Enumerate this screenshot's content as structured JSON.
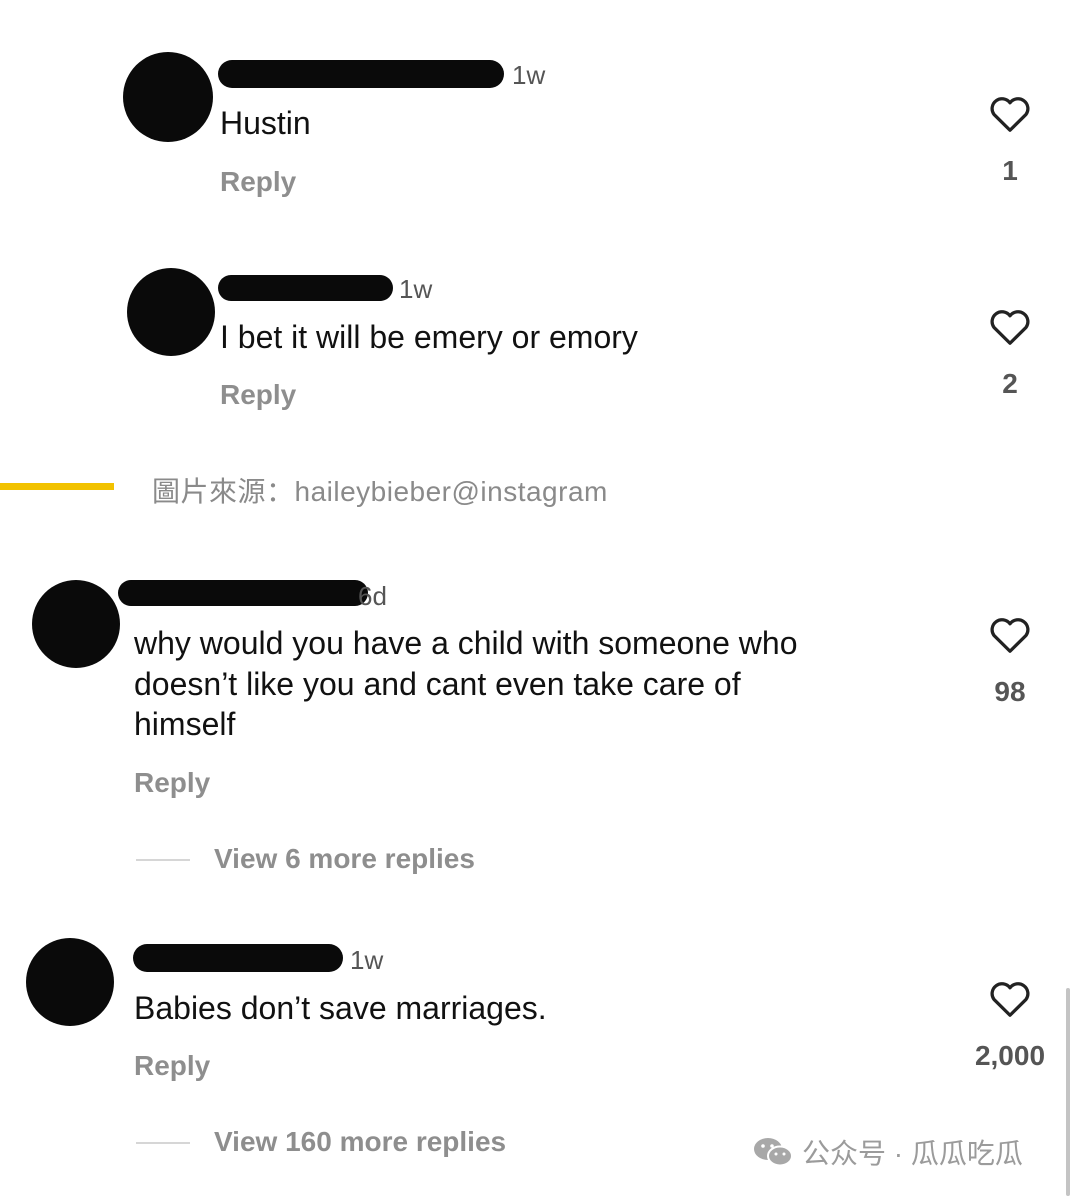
{
  "comments": [
    {
      "time": "1w",
      "text": "Hustin",
      "reply_label": "Reply",
      "likes": "1"
    },
    {
      "time": "1w",
      "text": "I bet it will be emery or emory",
      "reply_label": "Reply",
      "likes": "2"
    },
    {
      "time": "6d",
      "text_lines": [
        "why would you have a child with someone who",
        "doesn’t like you and cant even take care of",
        "himself"
      ],
      "reply_label": "Reply",
      "likes": "98",
      "view_more": "View 6 more replies"
    },
    {
      "time": "1w",
      "text": "Babies don’t save marriages.",
      "reply_label": "Reply",
      "likes": "2,000",
      "view_more": "View 160 more replies"
    }
  ],
  "image_caption": "圖片來源：haileybieber@instagram",
  "watermark": "公众号 · 瓜瓜吃瓜",
  "icons": {
    "like": "heart-outline-icon",
    "watermark": "wechat-icon"
  },
  "colors": {
    "accent_bar": "#f2c200",
    "muted_text": "#8e8e8e",
    "redaction": "#0a0a0a"
  }
}
